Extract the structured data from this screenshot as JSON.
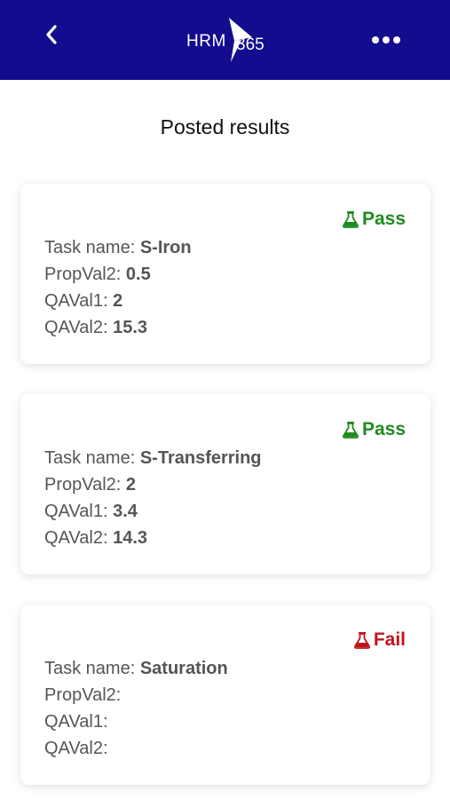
{
  "header": {
    "logo_left": "HRM",
    "logo_right": "365",
    "bg_color": "#130c8e"
  },
  "page": {
    "title": "Posted results"
  },
  "colors": {
    "pass": "#1f8a1f",
    "fail": "#c0141b"
  },
  "results": [
    {
      "status": "Pass",
      "status_icon": "flask-icon",
      "task_label": "Task name:",
      "task_value": "S-Iron",
      "propval2_label": "PropVal2:",
      "propval2_value": "0.5",
      "qaval1_label": "QAVal1:",
      "qaval1_value": "2",
      "qaval2_label": "QAVal2:",
      "qaval2_value": "15.3"
    },
    {
      "status": "Pass",
      "status_icon": "flask-icon",
      "task_label": "Task name:",
      "task_value": "S-Transferring",
      "propval2_label": "PropVal2:",
      "propval2_value": "2",
      "qaval1_label": "QAVal1:",
      "qaval1_value": "3.4",
      "qaval2_label": "QAVal2:",
      "qaval2_value": "14.3"
    },
    {
      "status": "Fail",
      "status_icon": "flask-icon",
      "task_label": "Task name:",
      "task_value": "Saturation",
      "propval2_label": "PropVal2:",
      "propval2_value": "",
      "qaval1_label": "QAVal1:",
      "qaval1_value": "",
      "qaval2_label": "QAVal2:",
      "qaval2_value": ""
    }
  ]
}
